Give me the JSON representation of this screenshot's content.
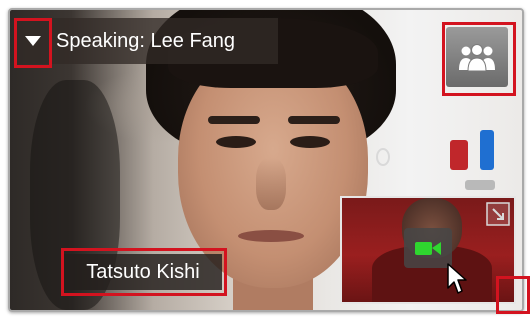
{
  "video": {
    "speaking_label": "Speaking: Lee Fang",
    "participant_name": "Tatsuto Kishi"
  },
  "icons": {
    "dropdown": "triangle-down-icon",
    "roster": "people-icon",
    "camera": "video-camera-icon",
    "expand": "expand-icon",
    "cursor": "mouse-pointer-icon"
  },
  "colors": {
    "highlight": "#d3131f",
    "camera_green": "#2fd62f",
    "overlay": "#322a26"
  }
}
